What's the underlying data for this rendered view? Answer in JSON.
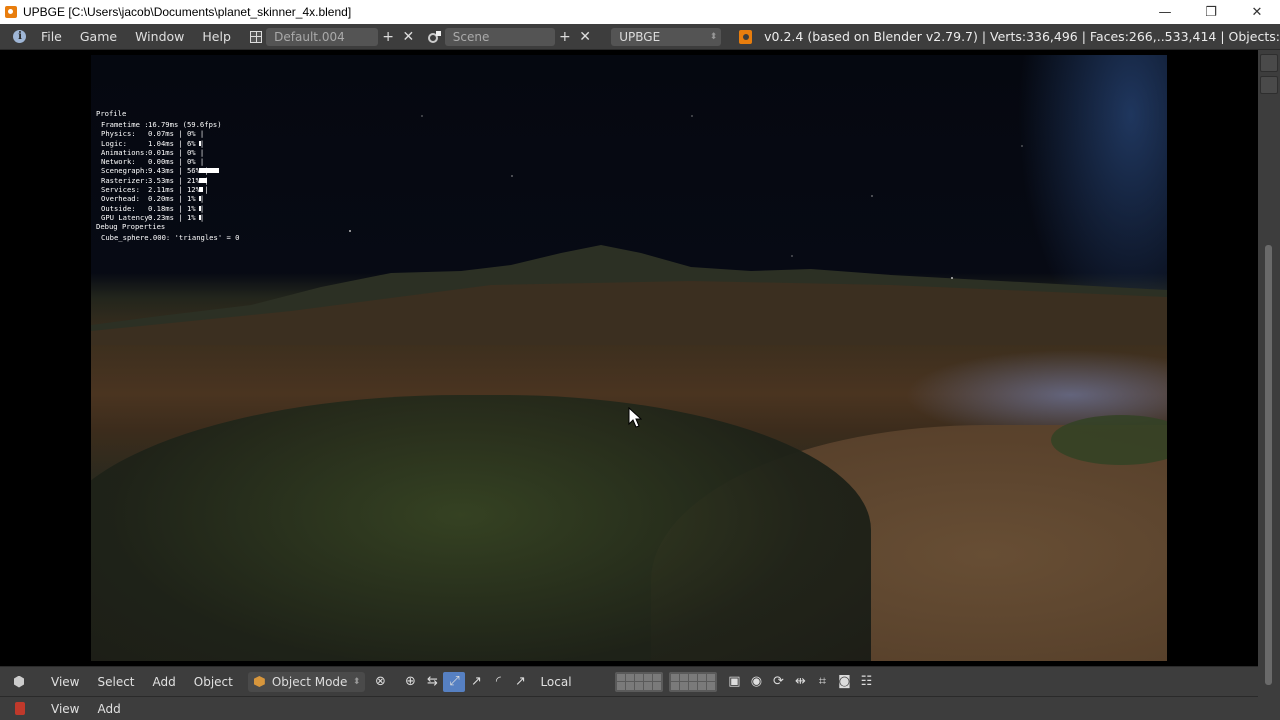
{
  "window": {
    "title": "UPBGE [C:\\Users\\jacob\\Documents\\planet_skinner_4x.blend]",
    "min_glyph": "—",
    "restore_glyph": "❐",
    "close_glyph": "✕"
  },
  "top_header": {
    "menus": [
      "File",
      "Game",
      "Window",
      "Help"
    ],
    "screen_layout": "Default.004",
    "scene": "Scene",
    "engine": "UPBGE",
    "stats": "v0.2.4 (based on Blender v2.79.7)  | Verts:336,496 | Faces:266,..533,414 | Objects:"
  },
  "profile": {
    "title": "Profile",
    "rows": [
      {
        "label": "Frametime :",
        "value": "16.79ms (59.6fps)",
        "bar": 0
      },
      {
        "label": "Physics:",
        "value": "0.07ms | 0% |",
        "bar": 0
      },
      {
        "label": "Logic:",
        "value": "1.04ms | 6% |",
        "bar": 6
      },
      {
        "label": "Animations:",
        "value": "0.01ms | 0% |",
        "bar": 0
      },
      {
        "label": "Network:",
        "value": "0.00ms | 0% |",
        "bar": 0
      },
      {
        "label": "Scenegraph:",
        "value": "9.43ms | 56% |",
        "bar": 56
      },
      {
        "label": "Rasterizer:",
        "value": "3.53ms | 21% |",
        "bar": 21
      },
      {
        "label": "Services:",
        "value": "2.11ms | 12% |",
        "bar": 12
      },
      {
        "label": "Overhead:",
        "value": "0.20ms | 1% |",
        "bar": 1
      },
      {
        "label": "Outside:",
        "value": "0.18ms | 1% |",
        "bar": 1
      },
      {
        "label": "GPU Latency:",
        "value": "0.23ms | 1% |",
        "bar": 1
      }
    ],
    "debug_title": "Debug Properties",
    "debug_property": "Cube_sphere.000: 'triangles' = 0"
  },
  "view_header": {
    "menus": [
      "View",
      "Select",
      "Add",
      "Object"
    ],
    "mode": "Object Mode",
    "orientation": "Local"
  },
  "timeline_header": {
    "menus": [
      "View",
      "Add"
    ]
  },
  "colors": {
    "header_bg": "#3d3d3d",
    "active_tool": "#5680c2",
    "brand_orange": "#e87d0d"
  }
}
